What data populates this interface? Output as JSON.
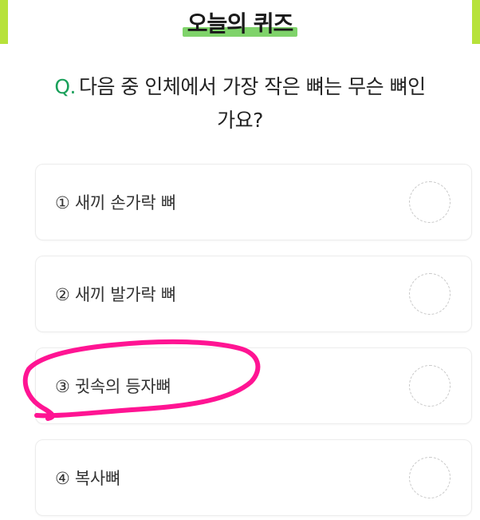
{
  "header": {
    "title": "오늘의 퀴즈"
  },
  "question": {
    "prefix": "Q.",
    "text": "다음 중 인체에서 가장 작은 뼈는 무슨 뼈인가요?"
  },
  "options": [
    {
      "label": "① 새끼 손가락 뼈"
    },
    {
      "label": "② 새끼 발가락 뼈"
    },
    {
      "label": "③ 귓속의 등자뼈"
    },
    {
      "label": "④ 복사뼈"
    }
  ],
  "colors": {
    "accent_bar": "#b7e23a",
    "title_highlight": "#7fd36a",
    "question_prefix": "#1aa05a",
    "annotation": "#ff1493"
  }
}
